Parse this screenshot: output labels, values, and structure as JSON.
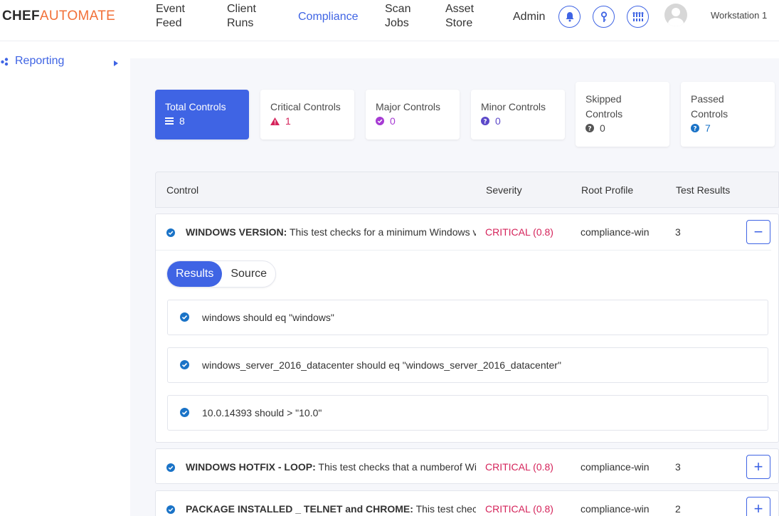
{
  "header": {
    "logo_bold": "CHEF",
    "logo_light": "AUTOMATE",
    "nav": [
      {
        "line1": "Event",
        "line2": "Feed"
      },
      {
        "line1": "Client",
        "line2": "Runs"
      },
      {
        "line1": "Compliance",
        "line2": ""
      },
      {
        "line1": "Scan",
        "line2": "Jobs"
      },
      {
        "line1": "Asset",
        "line2": "Store"
      },
      {
        "line1": "Admin",
        "line2": ""
      }
    ],
    "icons": [
      "bell-icon",
      "key-icon",
      "settings-icon"
    ],
    "workstation": "Workstation 1"
  },
  "sidebar": {
    "items": [
      {
        "label": "Reporting"
      }
    ]
  },
  "stats": [
    {
      "title": "Total Controls",
      "value": "8",
      "icon": "list-icon",
      "color": "#ffffff"
    },
    {
      "title": "Critical Controls",
      "value": "1",
      "icon": "warning-icon",
      "color": "#d5245b"
    },
    {
      "title": "Major Controls",
      "value": "0",
      "icon": "check-circle-icon",
      "color": "#a63bd3"
    },
    {
      "title": "Minor Controls",
      "value": "0",
      "icon": "question-circle-icon",
      "color": "#5c48c9"
    },
    {
      "title1": "Skipped",
      "title2": "Controls",
      "value": "0",
      "icon": "question-circle-icon",
      "color": "#4a4a4a"
    },
    {
      "title1": "Passed",
      "title2": "Controls",
      "value": "7",
      "icon": "question-circle-icon",
      "color": "#1a73c7"
    }
  ],
  "table": {
    "headers": {
      "control": "Control",
      "severity": "Severity",
      "profile": "Root Profile",
      "results": "Test Results"
    },
    "rows": [
      {
        "name": "WINDOWS VERSION:",
        "desc": "This test checks for a minimum Windows version",
        "severity": "CRITICAL (0.8)",
        "profile": "compliance-win",
        "results": "3",
        "toggle": "−"
      },
      {
        "name": "WINDOWS HOTFIX - LOOP:",
        "desc": "This test checks that a numberof Windows hotfixes",
        "severity": "CRITICAL (0.8)",
        "profile": "compliance-win",
        "results": "3",
        "toggle": "+"
      },
      {
        "name": "PACKAGE INSTALLED _ TELNET and CHROME:",
        "desc": "This test checks",
        "severity": "CRITICAL (0.8)",
        "profile": "compliance-win",
        "results": "2",
        "toggle": "+"
      }
    ]
  },
  "detail": {
    "tabs": [
      "Results",
      "Source"
    ],
    "results": [
      "windows should eq \"windows\"",
      "windows_server_2016_datacenter should eq \"windows_server_2016_datacenter\"",
      "10.0.14393 should > \"10.0\""
    ]
  },
  "colors": {
    "accent": "#3f64e4",
    "critical": "#d5245b",
    "logo_orange": "#f27038"
  }
}
